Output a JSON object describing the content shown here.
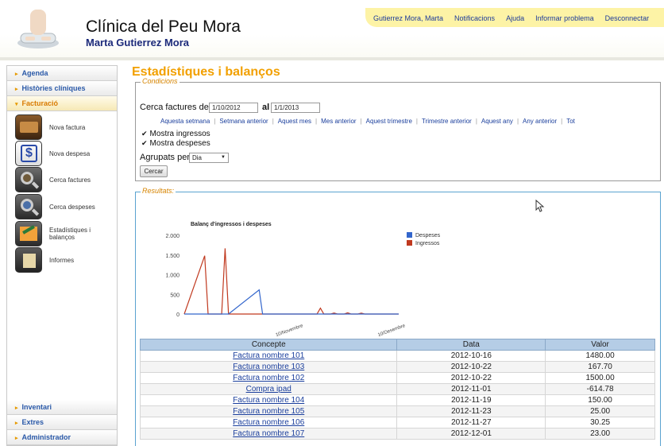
{
  "header": {
    "clinic_title": "Clínica del Peu Mora",
    "user_name": "Marta Gutierrez Mora",
    "top_links": [
      "Gutierrez Mora, Marta",
      "Notificacions",
      "Ajuda",
      "Informar problema",
      "Desconnectar"
    ]
  },
  "sidebar": {
    "sections_top": [
      {
        "label": "Agenda"
      },
      {
        "label": "Històries clíniques"
      },
      {
        "label": "Facturació",
        "active": true
      }
    ],
    "tools": [
      {
        "label": "Nova factura",
        "icon": "wallet-icon"
      },
      {
        "label": "Nova despesa",
        "icon": "dollar-icon"
      },
      {
        "label": "Cerca factures",
        "icon": "magnifier-icon"
      },
      {
        "label": "Cerca despeses",
        "icon": "magnifier-blue-icon"
      },
      {
        "label": "Estadístiques i balanços",
        "icon": "chart-icon"
      },
      {
        "label": "Informes",
        "icon": "report-icon"
      }
    ],
    "sections_bottom": [
      {
        "label": "Inventari"
      },
      {
        "label": "Extres"
      },
      {
        "label": "Administrador"
      }
    ]
  },
  "main": {
    "title": "Estadístiques i balanços",
    "conditions": {
      "legend": "Condicions",
      "search_label": "Cerca factures del",
      "date_from": "1/10/2012",
      "and_label": "al",
      "date_to": "1/1/2013",
      "quick_ranges": [
        "Aquesta setmana",
        "Setmana anterior",
        "Aquest mes",
        "Mes anterior",
        "Aquest trimestre",
        "Trimestre anterior",
        "Aquest any",
        "Any anterior",
        "Tot"
      ],
      "show_income": "Mostra ingressos",
      "show_expenses": "Mostra despeses",
      "grouped_label": "Agrupats per",
      "grouped_value": "Dia",
      "search_button": "Cercar"
    },
    "results_legend": "Resultats:",
    "colors": {
      "despeses": "#3366cc",
      "ingressos": "#c0391f"
    }
  },
  "chart_data": {
    "type": "line",
    "title": "Balanç d'ingressos i despeses",
    "x_ticks": [
      "10/Novembre",
      "10/Desembre"
    ],
    "y_ticks": [
      "2.000",
      "1.500",
      "1.000",
      "500",
      "0"
    ],
    "ylim": [
      0,
      2000
    ],
    "x": [
      "2012-10-16",
      "2012-10-17",
      "2012-10-21",
      "2012-10-22",
      "2012-10-23",
      "2012-11-01",
      "2012-11-02",
      "2012-11-18",
      "2012-11-19",
      "2012-11-20",
      "2012-11-22",
      "2012-11-23",
      "2012-11-24",
      "2012-11-26",
      "2012-11-27",
      "2012-11-28",
      "2012-11-30",
      "2012-12-01",
      "2012-12-02"
    ],
    "series": [
      {
        "name": "Despeses",
        "values": [
          0,
          0,
          0,
          0,
          0,
          615,
          0,
          0,
          0,
          0,
          0,
          0,
          0,
          0,
          0,
          0,
          0,
          0,
          0
        ]
      },
      {
        "name": "Ingressos",
        "values": [
          1480,
          0,
          0,
          1668,
          0,
          0,
          0,
          0,
          150,
          0,
          0,
          25,
          0,
          0,
          30,
          0,
          0,
          23,
          0
        ]
      }
    ],
    "legend_position": "right"
  },
  "table": {
    "columns": [
      "Concepte",
      "Data",
      "Valor"
    ],
    "rows": [
      [
        "Factura nombre 101",
        "2012-10-16",
        "1480.00"
      ],
      [
        "Factura nombre 103",
        "2012-10-22",
        "167.70"
      ],
      [
        "Factura nombre 102",
        "2012-10-22",
        "1500.00"
      ],
      [
        "Compra ipad",
        "2012-11-01",
        "-614.78"
      ],
      [
        "Factura nombre 104",
        "2012-11-19",
        "150.00"
      ],
      [
        "Factura nombre 105",
        "2012-11-23",
        "25.00"
      ],
      [
        "Factura nombre 106",
        "2012-11-27",
        "30.25"
      ],
      [
        "Factura nombre 107",
        "2012-12-01",
        "23.00"
      ]
    ]
  }
}
